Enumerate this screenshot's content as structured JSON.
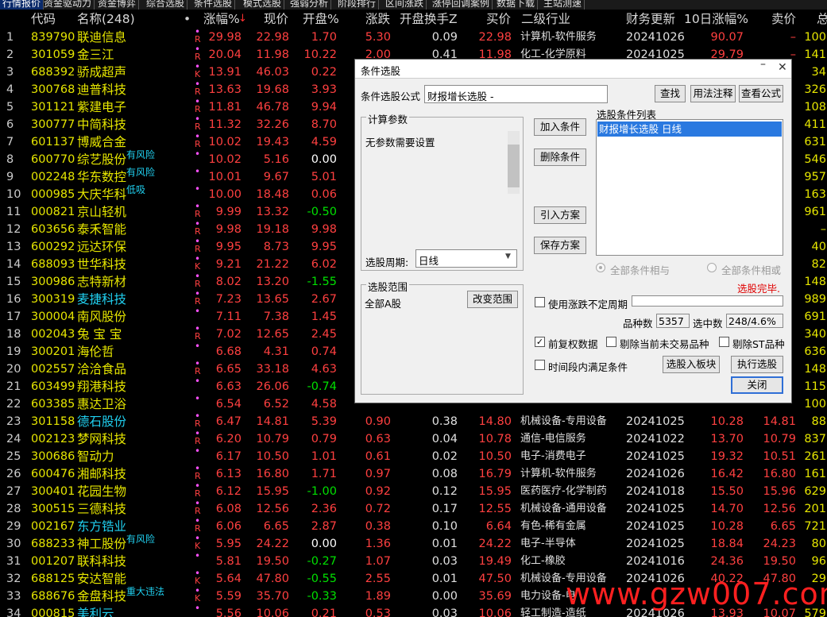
{
  "tabs": [
    "行情报价",
    "资金驱动力",
    "资金博弈",
    "综合选股",
    "条件选股",
    "模式选股",
    "强弱分析",
    "阶段排行",
    "区间涨跌",
    "涨停回调案例",
    "数据下载",
    "主站测速"
  ],
  "headers": {
    "code": "代码",
    "name": "名称(248)",
    "dot": "•",
    "pct": "涨幅%",
    "price": "现价",
    "open": "开盘%",
    "chg": "涨跌",
    "turn": "开盘换手Z",
    "buy": "买价",
    "ind": "二级行业",
    "upd": "财务更新",
    "d10": "10日涨幅%",
    "sell": "卖价",
    "tail": "总"
  },
  "rows": [
    {
      "no": "1",
      "code": "839790",
      "name": "联迪信息",
      "flag": "R",
      "pct": "29.98",
      "price": "22.98",
      "open": "1.70",
      "chg": "5.30",
      "turn": "0.09",
      "buy": "22.98",
      "ind": "计算机-软件服务",
      "upd": "20241026",
      "d10": "90.07",
      "sell": "–",
      "tail": "100"
    },
    {
      "no": "2",
      "code": "301059",
      "name": "金三江",
      "flag": "R",
      "pct": "20.04",
      "price": "11.98",
      "open": "10.22",
      "chg": "2.00",
      "turn": "0.41",
      "buy": "11.98",
      "ind": "化工-化学原料",
      "upd": "20241025",
      "d10": "29.79",
      "sell": "–",
      "tail": "141"
    },
    {
      "no": "3",
      "code": "688392",
      "name": "骄成超声",
      "flag": "K",
      "pct": "13.91",
      "price": "46.03",
      "open": "0.22",
      "tail": "34"
    },
    {
      "no": "4",
      "code": "300768",
      "name": "迪普科技",
      "flag": "R",
      "pct": "13.63",
      "price": "19.68",
      "open": "3.93",
      "tail": "326"
    },
    {
      "no": "5",
      "code": "301121",
      "name": "紫建电子",
      "flag": "R",
      "pct": "11.81",
      "price": "46.78",
      "open": "9.94",
      "tail": "108"
    },
    {
      "no": "6",
      "code": "300777",
      "name": "中简科技",
      "flag": "R",
      "pct": "11.32",
      "price": "32.26",
      "open": "8.70",
      "tail": "411"
    },
    {
      "no": "7",
      "code": "601137",
      "name": "博威合金",
      "flag": "R",
      "pct": "10.02",
      "price": "19.43",
      "open": "4.59",
      "tail": "631"
    },
    {
      "no": "8",
      "code": "600770",
      "name": "综艺股份",
      "note": "有风险",
      "pct": "10.02",
      "price": "5.16",
      "open": "0.00",
      "tail": "546"
    },
    {
      "no": "9",
      "code": "002248",
      "name": "华东数控",
      "note": "有风险",
      "pct": "10.01",
      "price": "9.67",
      "open": "5.01",
      "tail": "957"
    },
    {
      "no": "10",
      "code": "000985",
      "name": "大庆华科",
      "note": "低吸",
      "pct": "10.00",
      "price": "18.48",
      "open": "0.06",
      "tail": "163"
    },
    {
      "no": "11",
      "code": "000821",
      "name": "京山轻机",
      "flag": "R",
      "pct": "9.99",
      "price": "13.32",
      "open": "-0.50",
      "tail": "961"
    },
    {
      "no": "12",
      "code": "603656",
      "name": "泰禾智能",
      "flag": "R",
      "pct": "9.98",
      "price": "19.18",
      "open": "9.98",
      "tail": "–"
    },
    {
      "no": "13",
      "code": "600292",
      "name": "远达环保",
      "flag": "R",
      "pct": "9.95",
      "price": "8.73",
      "open": "9.95",
      "tail": "40"
    },
    {
      "no": "14",
      "code": "688093",
      "name": "世华科技",
      "flag": "K",
      "pct": "9.21",
      "price": "21.22",
      "open": "6.02",
      "tail": "82"
    },
    {
      "no": "15",
      "code": "300986",
      "name": "志特新材",
      "flag": "R",
      "pct": "8.02",
      "price": "13.20",
      "open": "-1.55",
      "tail": "148"
    },
    {
      "no": "16",
      "code": "300319",
      "name": "麦捷科技",
      "cy": true,
      "flag": "R",
      "pct": "7.23",
      "price": "13.65",
      "open": "2.67",
      "tail": "989"
    },
    {
      "no": "17",
      "code": "300004",
      "name": "南风股份",
      "pct": "7.11",
      "price": "7.38",
      "open": "1.45",
      "tail": "691"
    },
    {
      "no": "18",
      "code": "002043",
      "name": "兔 宝 宝",
      "flag": "R",
      "pct": "7.02",
      "price": "12.65",
      "open": "2.45",
      "tail": "340"
    },
    {
      "no": "19",
      "code": "300201",
      "name": "海伦哲",
      "pct": "6.68",
      "price": "4.31",
      "open": "0.74",
      "tail": "636"
    },
    {
      "no": "20",
      "code": "002557",
      "name": "洽洽食品",
      "flag": "R",
      "pct": "6.65",
      "price": "33.18",
      "open": "4.63",
      "tail": "148"
    },
    {
      "no": "21",
      "code": "603499",
      "name": "翔港科技",
      "pct": "6.63",
      "price": "26.06",
      "open": "-0.74",
      "tail": "115"
    },
    {
      "no": "22",
      "code": "603385",
      "name": "惠达卫浴",
      "pct": "6.54",
      "price": "6.52",
      "open": "4.58",
      "tail": "100"
    },
    {
      "no": "23",
      "code": "301158",
      "name": "德石股份",
      "cy": true,
      "flag": "R",
      "pct": "6.47",
      "price": "14.81",
      "open": "5.39",
      "chg": "0.90",
      "turn": "0.38",
      "buy": "14.80",
      "ind": "机械设备-专用设备",
      "upd": "20241025",
      "d10": "10.28",
      "sell": "14.81",
      "tail": "88"
    },
    {
      "no": "24",
      "code": "002123",
      "name": "梦网科技",
      "flag": "R",
      "pct": "6.20",
      "price": "10.79",
      "open": "0.79",
      "chg": "0.63",
      "turn": "0.04",
      "buy": "10.78",
      "ind": "通信-电信服务",
      "upd": "20241022",
      "d10": "13.70",
      "sell": "10.79",
      "tail": "837"
    },
    {
      "no": "25",
      "code": "300686",
      "name": "智动力",
      "pct": "6.17",
      "price": "10.50",
      "open": "1.01",
      "chg": "0.61",
      "turn": "0.02",
      "buy": "10.50",
      "ind": "电子-消费电子",
      "upd": "20241025",
      "d10": "19.32",
      "sell": "10.51",
      "tail": "261"
    },
    {
      "no": "26",
      "code": "600476",
      "name": "湘邮科技",
      "flag": "R",
      "pct": "6.13",
      "price": "16.80",
      "open": "1.71",
      "chg": "0.97",
      "turn": "0.08",
      "buy": "16.79",
      "ind": "计算机-软件服务",
      "upd": "20241026",
      "d10": "16.42",
      "sell": "16.80",
      "tail": "161"
    },
    {
      "no": "27",
      "code": "300401",
      "name": "花园生物",
      "flag": "R",
      "pct": "6.12",
      "price": "15.95",
      "open": "-1.00",
      "chg": "0.92",
      "turn": "0.12",
      "buy": "15.95",
      "ind": "医药医疗-化学制药",
      "upd": "20241018",
      "d10": "15.50",
      "sell": "15.96",
      "tail": "629"
    },
    {
      "no": "28",
      "code": "300515",
      "name": "三德科技",
      "flag": "R",
      "pct": "6.08",
      "price": "12.56",
      "open": "2.36",
      "chg": "0.72",
      "turn": "0.17",
      "buy": "12.55",
      "ind": "机械设备-通用设备",
      "upd": "20241025",
      "d10": "14.70",
      "sell": "12.56",
      "tail": "201"
    },
    {
      "no": "29",
      "code": "002167",
      "name": "东方锆业",
      "cy": true,
      "flag": "R",
      "pct": "6.06",
      "price": "6.65",
      "open": "2.87",
      "chg": "0.38",
      "turn": "0.10",
      "buy": "6.64",
      "ind": "有色-稀有金属",
      "upd": "20241025",
      "d10": "10.28",
      "sell": "6.65",
      "tail": "721"
    },
    {
      "no": "30",
      "code": "688233",
      "name": "神工股份",
      "note": "有风险",
      "flag": "K",
      "pct": "5.95",
      "price": "24.22",
      "open": "0.00",
      "chg": "1.36",
      "turn": "0.01",
      "buy": "24.22",
      "ind": "电子-半导体",
      "upd": "20241025",
      "d10": "18.84",
      "sell": "24.23",
      "tail": "80"
    },
    {
      "no": "31",
      "code": "001207",
      "name": "联科科技",
      "pct": "5.81",
      "price": "19.50",
      "open": "-0.27",
      "chg": "1.07",
      "turn": "0.03",
      "buy": "19.49",
      "ind": "化工-橡胶",
      "upd": "20241016",
      "d10": "24.36",
      "sell": "19.50",
      "tail": "96"
    },
    {
      "no": "32",
      "code": "688125",
      "name": "安达智能",
      "flag": "K",
      "pct": "5.64",
      "price": "47.80",
      "open": "-0.55",
      "chg": "2.55",
      "turn": "0.01",
      "buy": "47.50",
      "ind": "机械设备-专用设备",
      "upd": "20241026",
      "d10": "40.22",
      "sell": "47.80",
      "tail": "29"
    },
    {
      "no": "33",
      "code": "688676",
      "name": "金盘科技",
      "note": "重大违法",
      "flag": "K",
      "pct": "5.59",
      "price": "35.70",
      "open": "-0.33",
      "chg": "1.89",
      "turn": "0.00",
      "buy": "35.69",
      "ind": "电力设备-电",
      "upd": "",
      "d10": "",
      "sell": "",
      "tail": ""
    },
    {
      "no": "34",
      "code": "000815",
      "name": "美利云",
      "cy": true,
      "pct": "5.56",
      "price": "10.06",
      "open": "0.21",
      "chg": "0.53",
      "turn": "0.03",
      "buy": "10.06",
      "ind": "轻工制造-造纸",
      "upd": "20241026",
      "d10": "13.93",
      "sell": "10.07",
      "tail": "579"
    }
  ],
  "dialog": {
    "title": "条件选股",
    "formula_label": "条件选股公式",
    "formula_value": "财报增长选股  -",
    "btn_find": "查找",
    "btn_usage": "用法注释",
    "btn_view": "查看公式",
    "calc_params": "计算参数",
    "no_params": "无参数需要设置",
    "period_label": "选股周期:",
    "period_value": "日线",
    "btn_add": "加入条件",
    "btn_delete": "删除条件",
    "btn_import": "引入方案",
    "btn_save": "保存方案",
    "cond_list_label": "选股条件列表",
    "cond_item": "财报增长选股  日线",
    "radio_and": "全部条件相与",
    "radio_or": "全部条件相或",
    "done": "选股完毕.",
    "range_label": "选股范围",
    "range_value": "全部A股",
    "btn_change": "改变范围",
    "chk_uncertain": "使用涨跌不定周期",
    "count_label": "品种数",
    "count_value": "5357",
    "selected_label": "选中数",
    "selected_value": "248/4.6%",
    "chk_adjust": "前复权数据",
    "chk_exclude_untraded": "剔除当前未交易品种",
    "chk_exclude_st": "剔除ST品种",
    "chk_period": "时间段内满足条件",
    "btn_to_block": "选股入板块",
    "btn_execute": "执行选股",
    "btn_close": "关闭"
  },
  "watermark": "www.gzw007.com"
}
